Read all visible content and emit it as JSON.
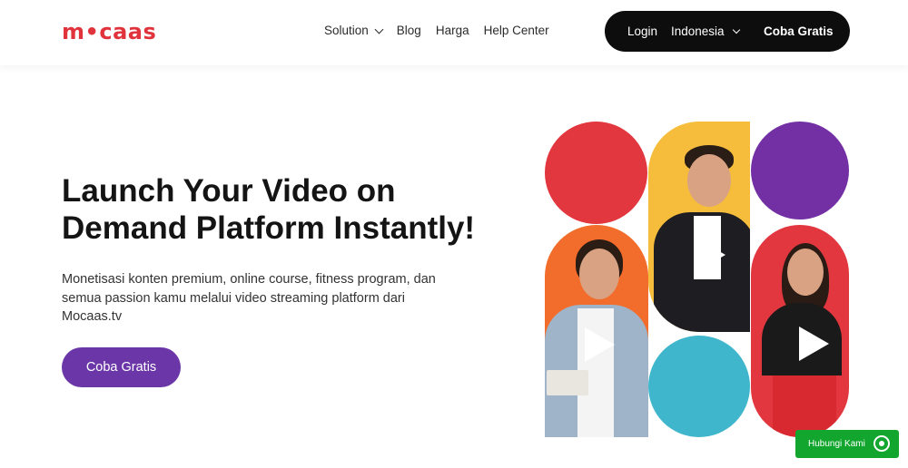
{
  "brand": {
    "logo_text": "m•caas",
    "color": "#e0333c"
  },
  "nav": {
    "items": [
      {
        "label": "Solution",
        "has_dropdown": true
      },
      {
        "label": "Blog"
      },
      {
        "label": "Harga"
      },
      {
        "label": "Help Center"
      }
    ]
  },
  "account": {
    "login_label": "Login",
    "language": "Indonesia",
    "cta_label": "Coba Gratis"
  },
  "hero": {
    "title": "Launch Your Video on Demand Platform Instantly!",
    "description": "Monetisasi konten premium, online course, fitness program, dan semua passion kamu melalui video streaming platform dari Mocaas.tv",
    "cta_label": "Coba Gratis",
    "cta_color": "#6b37a8"
  },
  "collage_colors": {
    "red": "#e2373f",
    "yellow": "#f6bd3c",
    "purple": "#7330a4",
    "orange": "#f26d2b",
    "blue": "#3fb6cc"
  },
  "whatsapp": {
    "label": "Hubungi Kami",
    "icon": "whatsapp-icon",
    "color": "#12a62e"
  }
}
